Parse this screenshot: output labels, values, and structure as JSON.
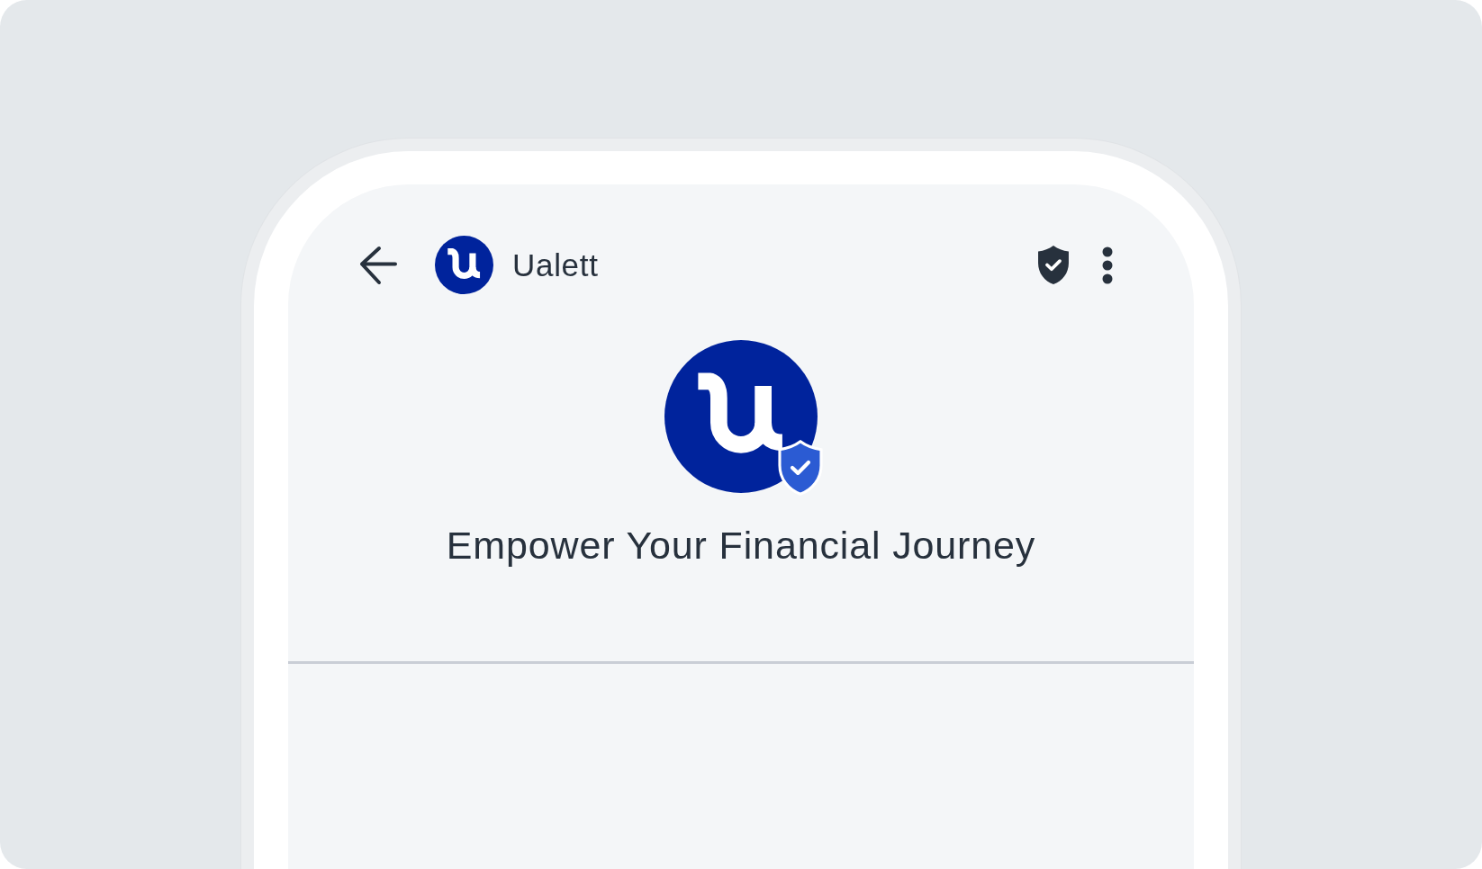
{
  "app_bar": {
    "title": "Ualett"
  },
  "hero": {
    "headline": "Empower Your Financial Journey",
    "verified": true
  }
}
